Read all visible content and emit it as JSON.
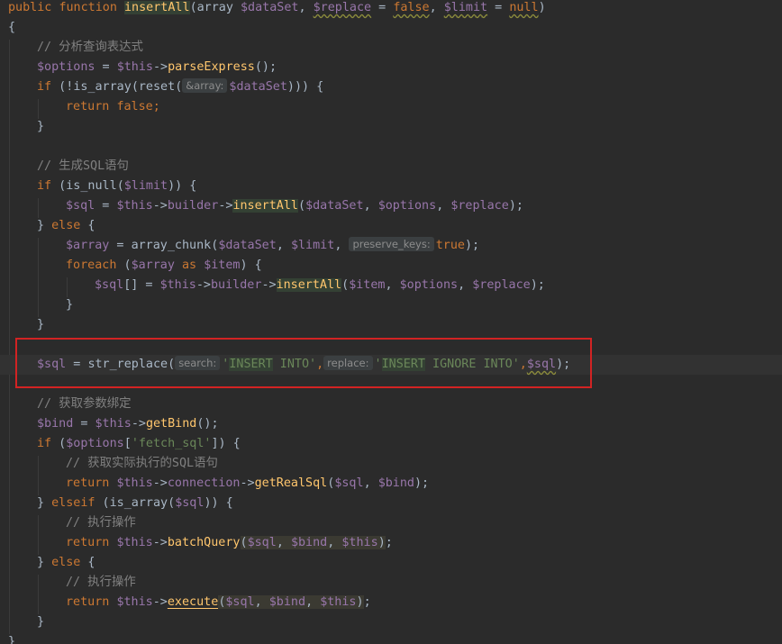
{
  "code": {
    "l1": [
      "public",
      " ",
      "function",
      " ",
      "insertAll",
      "(array ",
      "$dataSet",
      ", ",
      "$replace",
      " = ",
      "false",
      ", ",
      "$limit",
      " = ",
      "null",
      ")"
    ],
    "l2": "{",
    "l3": "// 分析查询表达式",
    "l4": [
      "$options",
      " = ",
      "$this",
      "->",
      "parseExpress",
      "();"
    ],
    "l5": [
      "if",
      " (!",
      "is_array",
      "(",
      "reset",
      "(",
      "&array:",
      "$dataSet",
      "))) {"
    ],
    "l6": [
      "return",
      " ",
      "false",
      ";"
    ],
    "l7": "}",
    "l9": "// 生成SQL语句",
    "l10": [
      "if",
      " (",
      "is_null",
      "(",
      "$limit",
      ")) {"
    ],
    "l11": [
      "$sql",
      " = ",
      "$this",
      "->",
      "builder",
      "->",
      "insertAll",
      "(",
      "$dataSet",
      ", ",
      "$options",
      ", ",
      "$replace",
      ");"
    ],
    "l12": [
      "} ",
      "else",
      " {"
    ],
    "l13": [
      "$array",
      " = ",
      "array_chunk",
      "(",
      "$dataSet",
      ", ",
      "$limit",
      ", ",
      "preserve_keys:",
      "true",
      ");"
    ],
    "l14": [
      "foreach",
      " (",
      "$array",
      " as ",
      "$item",
      ") {"
    ],
    "l15": [
      "$sql",
      "[] = ",
      "$this",
      "->",
      "builder",
      "->",
      "insertAll",
      "(",
      "$item",
      ", ",
      "$options",
      ", ",
      "$replace",
      ");"
    ],
    "l16": "}",
    "l17": "}",
    "l19": [
      "$sql",
      " = ",
      "str_replace",
      "(",
      "search:",
      "'",
      "INSERT",
      " INTO'",
      ",",
      "replace:",
      "'",
      "INSERT",
      " IGNORE INTO'",
      ",",
      "$sql",
      ");"
    ],
    "l21": "// 获取参数绑定",
    "l22": [
      "$bind",
      " = ",
      "$this",
      "->",
      "getBind",
      "();"
    ],
    "l23": [
      "if",
      " (",
      "$options",
      "[",
      "'fetch_sql'",
      "]) {"
    ],
    "l24": "// 获取实际执行的SQL语句",
    "l25": [
      "return",
      " ",
      "$this",
      "->",
      "connection",
      "->",
      "getRealSql",
      "(",
      "$sql",
      ", ",
      "$bind",
      ");"
    ],
    "l26": [
      "} ",
      "elseif",
      " (",
      "is_array",
      "(",
      "$sql",
      ")) {"
    ],
    "l27": "// 执行操作",
    "l28": [
      "return",
      " ",
      "$this",
      "->",
      "batchQuery",
      "(",
      "$sql",
      ", ",
      "$bind",
      ", ",
      "$this",
      ")",
      ";"
    ],
    "l29": [
      "} ",
      "else",
      " {"
    ],
    "l30": "// 执行操作",
    "l31": [
      "return",
      " ",
      "$this",
      "->",
      "execute",
      "(",
      "$sql",
      ", ",
      "$bind",
      ", ",
      "$this",
      ")",
      ";"
    ],
    "l32": "}",
    "l33": "}"
  },
  "colors": {
    "background": "#2b2b2b",
    "keyword": "#cc7832",
    "function": "#ffc66d",
    "variable": "#9876aa",
    "comment": "#808080",
    "string": "#6a8759",
    "annotation_box": "#d22323"
  }
}
